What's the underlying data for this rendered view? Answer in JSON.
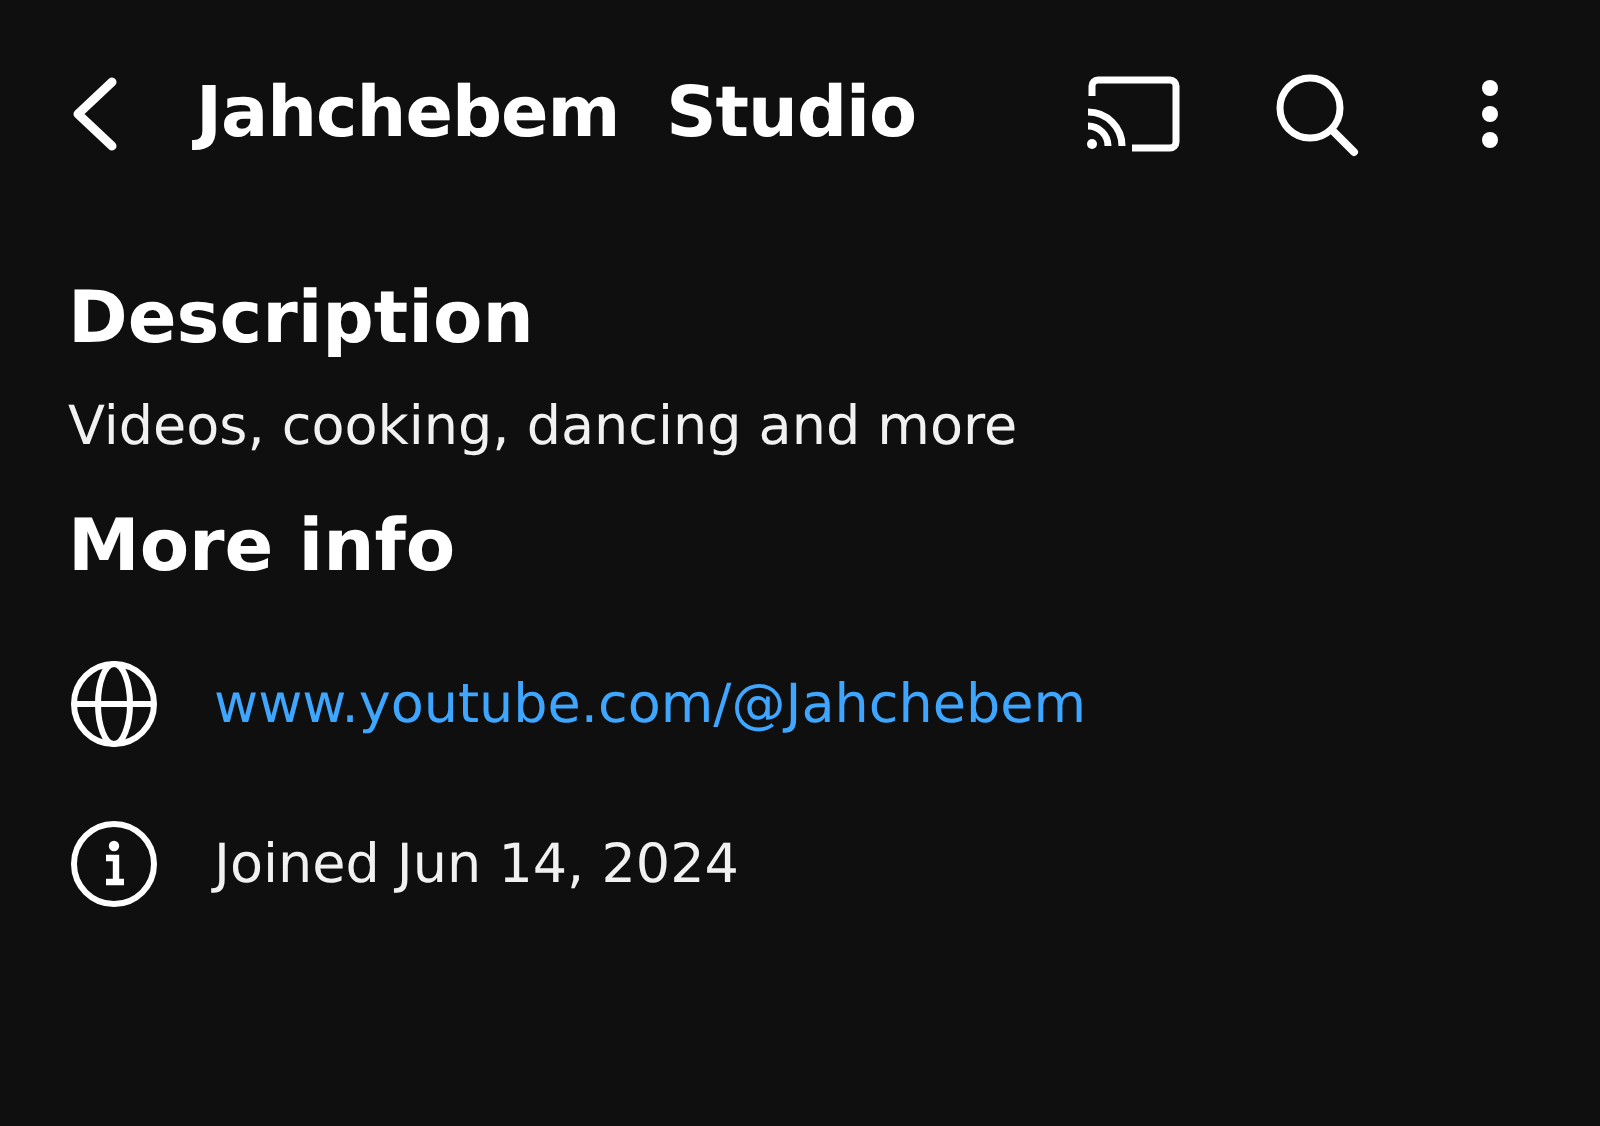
{
  "header": {
    "title": "Jahchebem  Studio"
  },
  "description": {
    "heading": "Description",
    "text": "Videos, cooking, dancing and more"
  },
  "more_info": {
    "heading": "More info",
    "items": [
      {
        "kind": "link",
        "text": "www.youtube.com/@Jahchebem"
      },
      {
        "kind": "joined",
        "text": "Joined Jun 14, 2024"
      }
    ]
  }
}
